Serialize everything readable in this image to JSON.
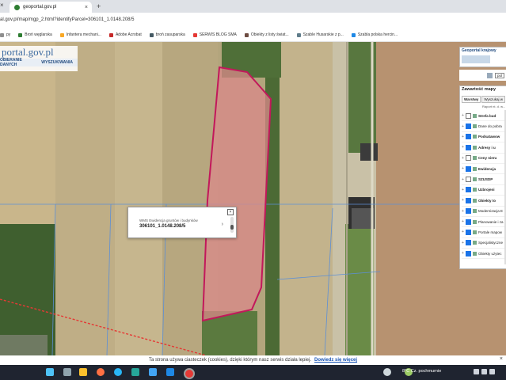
{
  "browser": {
    "tab_title": "geoportal.gov.pl",
    "tab_close": "×",
    "new_tab": "+",
    "window_close": "×",
    "url": "al.gov.pl/map/mgp_2.html?identifyParcel=306101_1.0148.208/5"
  },
  "bookmarks": [
    {
      "label": "py",
      "color": "#8e8e8e"
    },
    {
      "label": "Broń węglarska",
      "color": "#2e7d32"
    },
    {
      "label": "Infantera mechani...",
      "color": "#f9a825"
    },
    {
      "label": "Adobe Acrobat",
      "color": "#c62828"
    },
    {
      "label": "broń zasuparska",
      "color": "#455a64"
    },
    {
      "label": "SERWIS BLOG SMA",
      "color": "#e53935"
    },
    {
      "label": "Obiekty z listy świat...",
      "color": "#6d4c41"
    },
    {
      "label": "Szable Husarskie z p...",
      "color": "#607d8b"
    },
    {
      "label": "Szabla polska hercin...",
      "color": "#1e88e5"
    }
  ],
  "logo": {
    "brand": "portal.gov.pl",
    "menu": [
      "OBIERANIE DANYCH",
      "WYSZUKIWANIA"
    ]
  },
  "popup": {
    "header": "WMS Ewidencja gruntów i budynków",
    "parcel_id": "306101_1.0148.208/5",
    "close": "×",
    "next_arrow": "›"
  },
  "right_panel": {
    "geoportal_box_title": "Geoportal krajowy",
    "select_label": "pol",
    "layers_title": "Zawartość mapy",
    "tabs": [
      "Warstwy",
      "Wyszukaj w"
    ],
    "column_header": "Raport nt. d. w...",
    "layers": [
      {
        "name": "Strefa bud",
        "checked": false,
        "bold": true
      },
      {
        "name": "Dane do pobra",
        "checked": true,
        "bold": false
      },
      {
        "name": "Podsatawow",
        "checked": true,
        "bold": true
      },
      {
        "name": "Adresy i u",
        "checked": true,
        "bold": true
      },
      {
        "name": "Ceny nieru",
        "checked": false,
        "bold": true
      },
      {
        "name": "Ewidencja",
        "checked": true,
        "bold": true
      },
      {
        "name": "SZUSDP",
        "checked": false,
        "bold": true
      },
      {
        "name": "Uzbrojeni",
        "checked": true,
        "bold": true
      },
      {
        "name": "Obiekty to",
        "checked": true,
        "bold": true
      },
      {
        "name": "Modernizacja E",
        "checked": true,
        "bold": false
      },
      {
        "name": "Planowanie i za",
        "checked": true,
        "bold": false
      },
      {
        "name": "Portale mapow",
        "checked": true,
        "bold": false
      },
      {
        "name": "Specjalistyczne",
        "checked": true,
        "bold": false
      },
      {
        "name": "Obiekty użytec",
        "checked": true,
        "bold": false
      }
    ]
  },
  "cookie_bar": {
    "text": "Ta strona używa ciasteczek (cookies), dzięki którym nasz serwis działa lepiej.",
    "link": "Dowiedz się więcej",
    "close": "×"
  },
  "taskbar": {
    "tray_text": "8°C  Cz. pochmurnie"
  },
  "colors": {
    "parcel_outline": "#c2185b",
    "parcel_fill": "#d98a8a",
    "parcel_line": "#e53935",
    "grid_line": "#5c8fd6"
  }
}
